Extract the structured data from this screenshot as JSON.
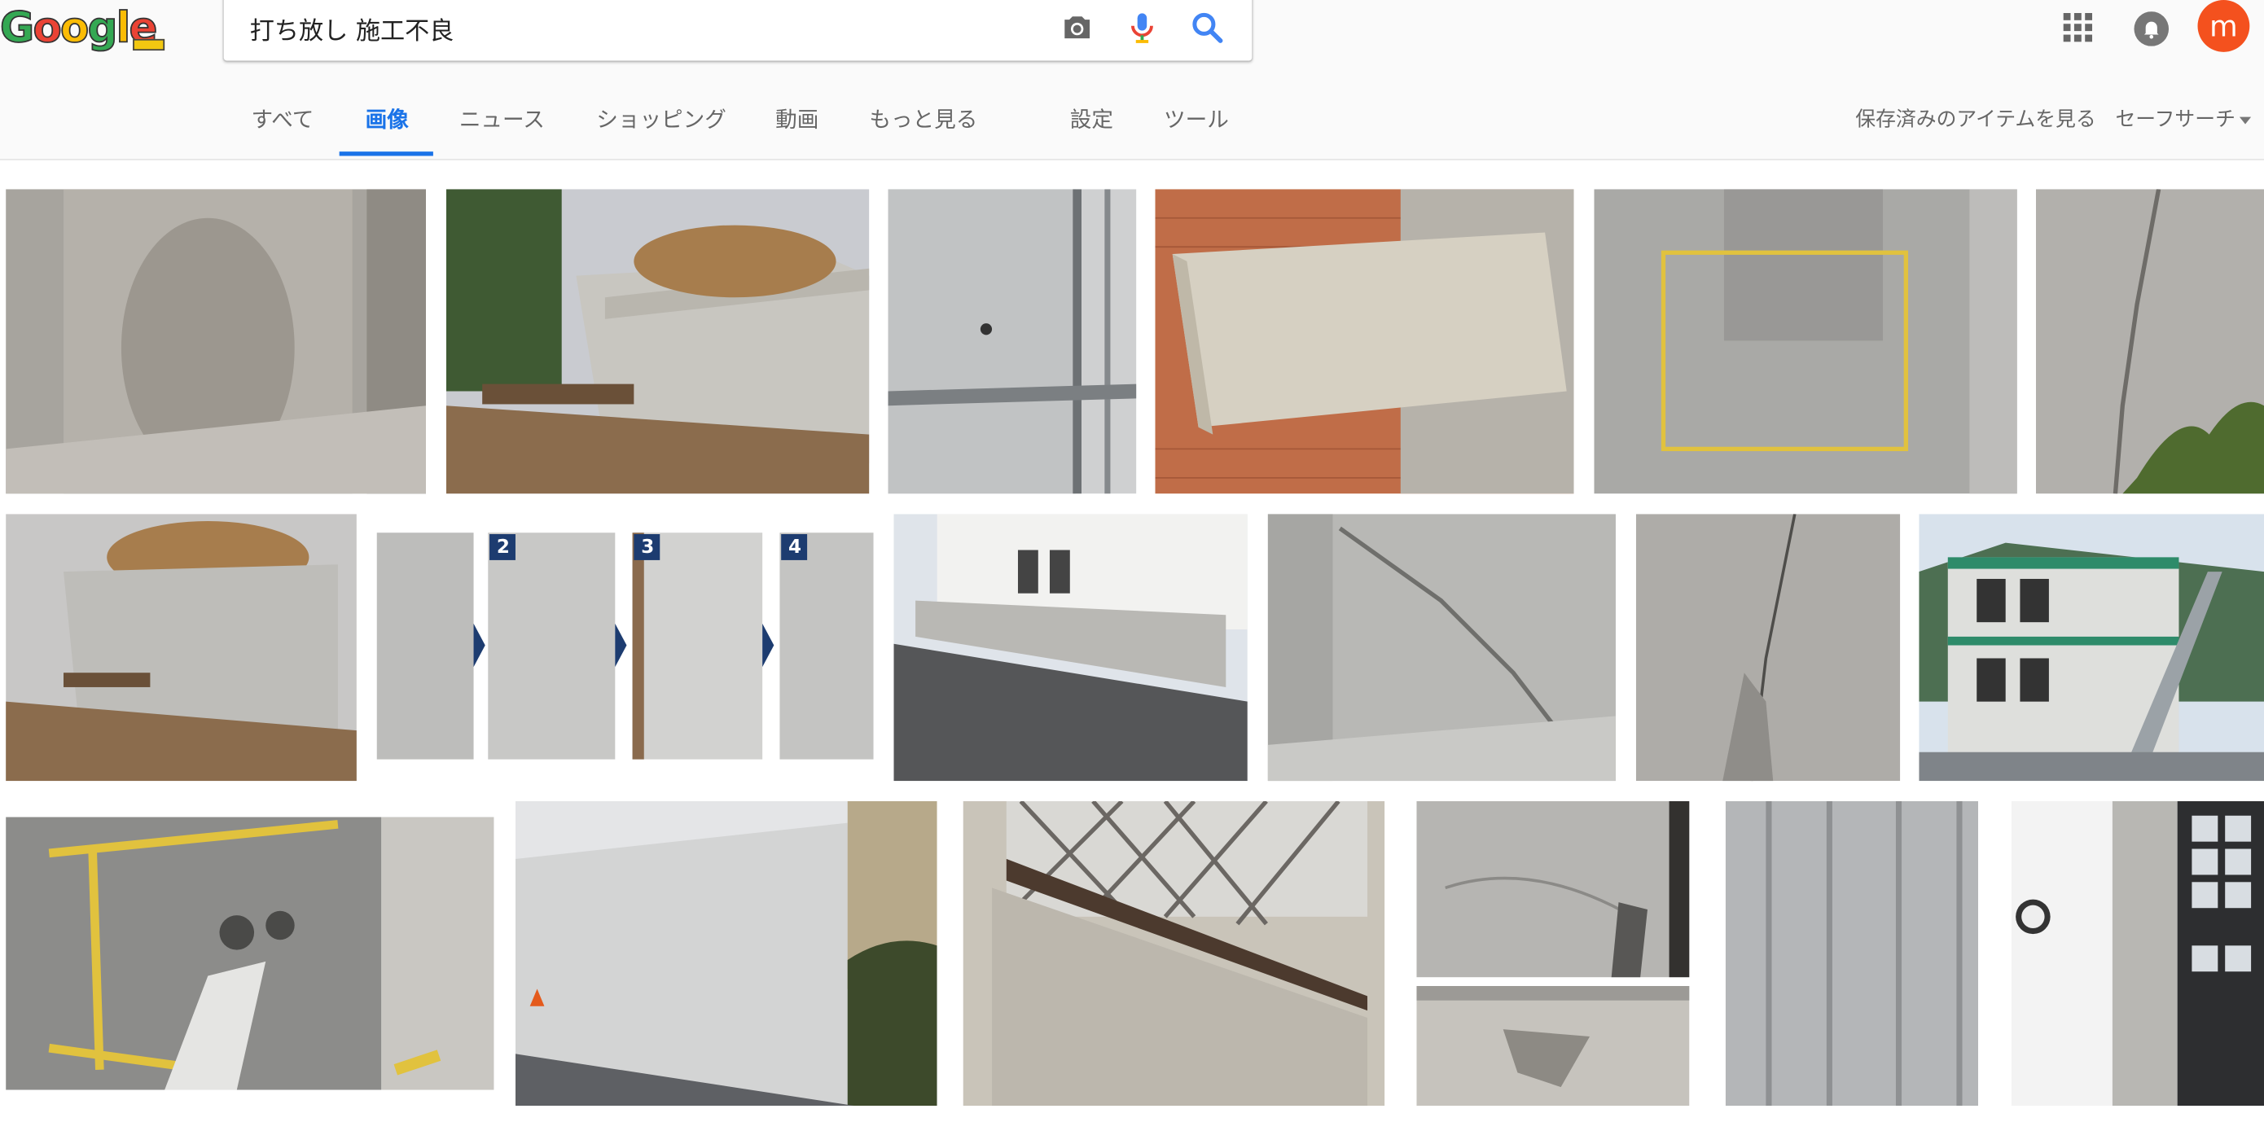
{
  "logo": {
    "letters": [
      "G",
      "o",
      "o",
      "g",
      "l",
      "e"
    ],
    "colors": [
      "#34a853",
      "#ea4335",
      "#fbbc05",
      "#34a853",
      "#fbbc05",
      "#ea4335"
    ],
    "tag": ""
  },
  "search": {
    "query": "打ち放し 施工不良"
  },
  "icons": {
    "camera": "camera-icon",
    "mic": "mic-icon",
    "search": "search-icon",
    "apps": "apps-grid-icon",
    "notifications": "bell-icon"
  },
  "account": {
    "initial": "m",
    "color": "#f4511e"
  },
  "tabs": [
    {
      "label": "すべて",
      "active": false
    },
    {
      "label": "画像",
      "active": true
    },
    {
      "label": "ニュース",
      "active": false
    },
    {
      "label": "ショッピング",
      "active": false
    },
    {
      "label": "動画",
      "active": false
    },
    {
      "label": "もっと見る",
      "active": false
    },
    {
      "label": "設定",
      "active": false
    },
    {
      "label": "ツール",
      "active": false
    }
  ],
  "right_links": {
    "saved": "保存済みのアイテムを見る",
    "safesearch": "セーフサーチ"
  },
  "accent": "#1a73e8",
  "results": [
    {
      "alt": "rough concrete wall corner with honeycomb"
    },
    {
      "alt": "concrete retaining wall with soil pile"
    },
    {
      "alt": "concrete wall with scaffolding"
    },
    {
      "alt": "concrete beam against brick wall"
    },
    {
      "alt": "concrete wall with yellow marked rectangle"
    },
    {
      "alt": "concrete wall with crack and plants"
    },
    {
      "alt": "concrete retaining wall with debris"
    },
    {
      "alt": "repair step sequence",
      "steps": [
        "2",
        "3",
        "4"
      ]
    },
    {
      "alt": "house with concrete block fence"
    },
    {
      "alt": "cracked concrete wall"
    },
    {
      "alt": "crack in concrete surface"
    },
    {
      "alt": "two-storey prefab building"
    },
    {
      "alt": "concrete repair with yellow tape"
    },
    {
      "alt": "exposed concrete wall along street"
    },
    {
      "alt": "stucco wall with lattice window"
    },
    {
      "alt": "concrete wall with efflorescence"
    },
    {
      "alt": "concrete surface stains"
    },
    {
      "alt": "vertical seams on concrete wall"
    },
    {
      "alt": "concrete pillar beside glass block wall"
    }
  ]
}
